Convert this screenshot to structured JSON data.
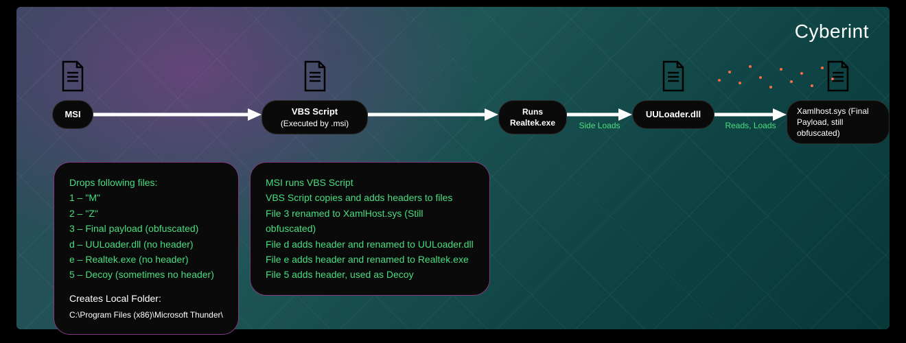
{
  "brand": "Cyberint",
  "nodes": {
    "msi": {
      "label": "MSI"
    },
    "vbs": {
      "label": "VBS Script",
      "sub": "(Executed by .msi)"
    },
    "runs": {
      "label": "Runs\nRealtek.exe"
    },
    "uul": {
      "label": "UULoader.dll"
    },
    "xaml": {
      "label": "Xamlhost.sys (Final Payload, still obfuscated)"
    }
  },
  "arrows": {
    "a1": "",
    "a2": "",
    "a3": "Side Loads",
    "a4": "Reads, Loads"
  },
  "desc1": {
    "heading": "Drops following files:",
    "items": [
      "1 – \"M\"",
      "2 – \"Z\"",
      "3 – Final payload (obfuscated)",
      "d – UULoader.dll (no header)",
      "e – Realtek.exe (no header)",
      "5 – Decoy (sometimes no header)"
    ],
    "sub_heading": "Creates Local Folder:",
    "path": "C:\\Program Files (x86)\\Microsoft Thunder\\"
  },
  "desc2": {
    "lines": [
      "MSI runs VBS Script",
      "VBS Script copies and adds headers to files",
      "File 3 renamed to XamlHost.sys (Still obfuscated)",
      "File d adds header and renamed to UULoader.dll",
      "File e adds header and renamed to Realtek.exe",
      "File 5 adds header, used as Decoy"
    ]
  }
}
